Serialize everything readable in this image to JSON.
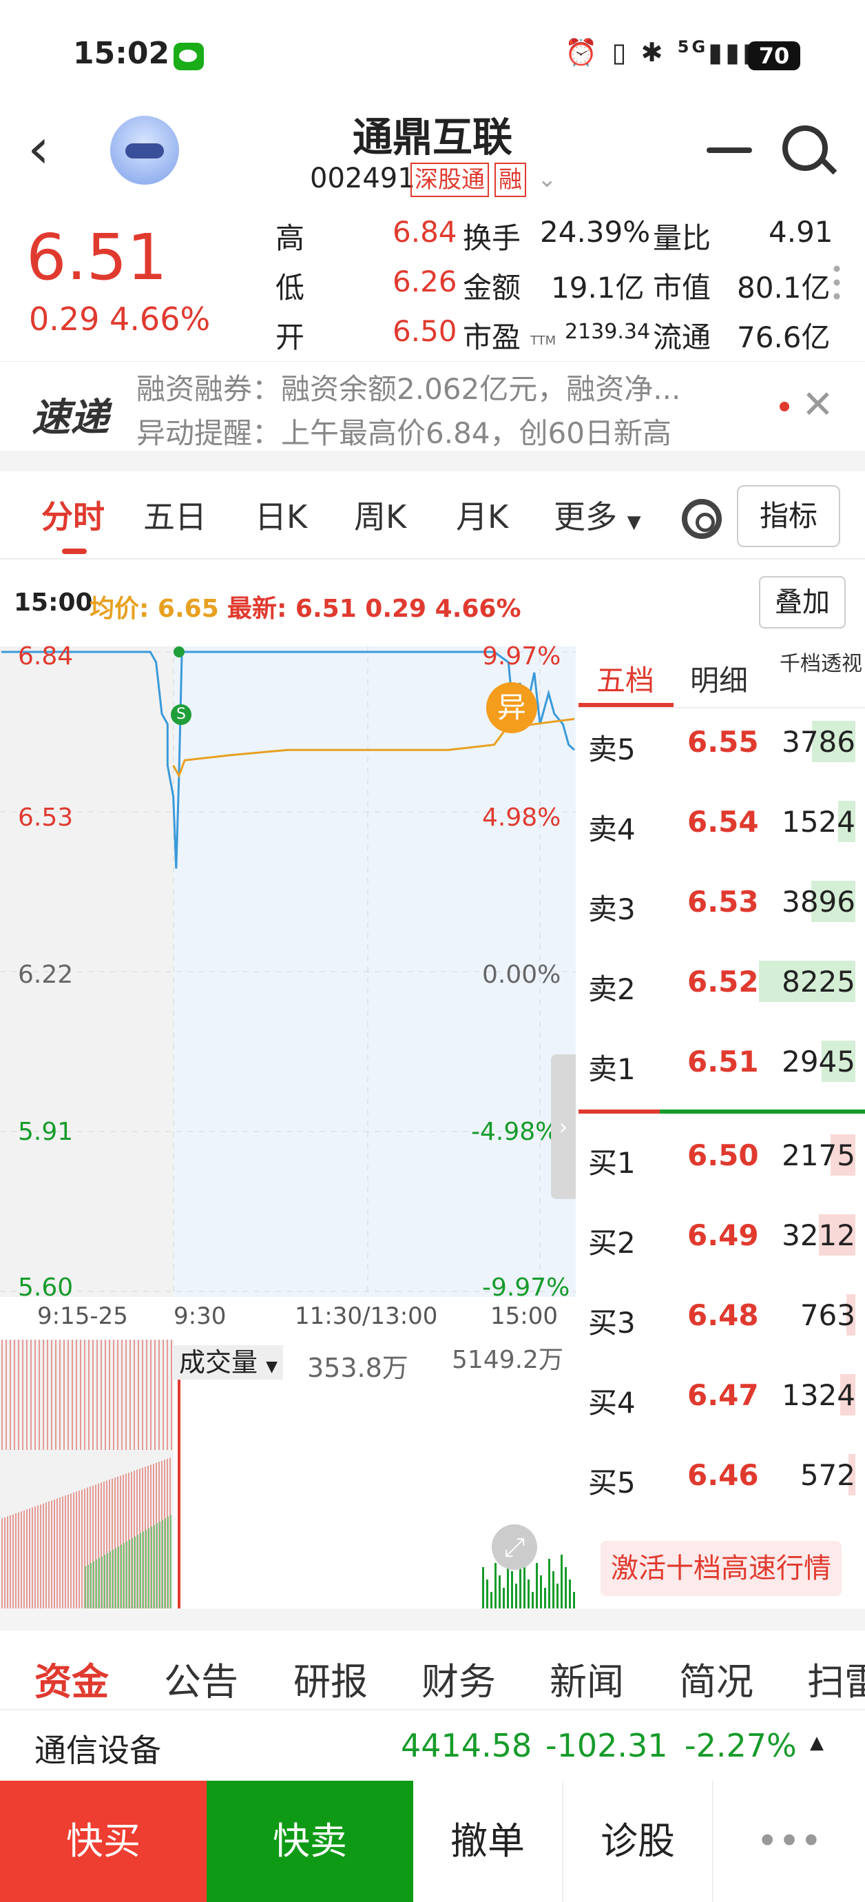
{
  "status_bar": {
    "time": "15:02",
    "network": "5G",
    "battery": "70"
  },
  "header": {
    "name": "通鼎互联",
    "code": "002491",
    "tag1": "深股通",
    "tag2": "融"
  },
  "quote": {
    "price": "6.51",
    "change": "0.29",
    "change_pct": "4.66%",
    "fields": [
      {
        "label": "高",
        "value": "6.84",
        "label2": "换手",
        "value2": "24.39%",
        "label3": "量比",
        "value3": "4.91"
      },
      {
        "label": "低",
        "value": "6.26",
        "label2": "金额",
        "value2": "19.1亿",
        "label3": "市值",
        "value3": "80.1亿"
      },
      {
        "label": "开",
        "value": "6.50",
        "label2": "市盈",
        "sub2": "TTM",
        "value2": "2139.34",
        "label3": "流通",
        "value3": "76.6亿"
      }
    ]
  },
  "news": {
    "logo": "速递",
    "line1": "融资融券：融资余额2.062亿元，融资净...",
    "line2": "异动提醒：上午最高价6.84，创60日新高"
  },
  "tabs": [
    "分时",
    "五日",
    "日K",
    "周K",
    "月K",
    "更多"
  ],
  "index_button": "指标",
  "info": {
    "time": "15:00",
    "avg_label": "均价: 6.65",
    "latest_label": "最新: 6.51 0.29 4.66%"
  },
  "overlay_button": "叠加",
  "chart_data": {
    "type": "line",
    "y_left_ticks": [
      "6.84",
      "6.53",
      "6.22",
      "5.91",
      "5.60"
    ],
    "y_right_ticks": [
      "9.97%",
      "4.98%",
      "0.00%",
      "-4.98%",
      "-9.97%"
    ],
    "x_ticks": [
      "9:15-25",
      "9:30",
      "11:30/13:00",
      "15:00"
    ],
    "ylim": [
      5.6,
      6.84
    ],
    "prev_close": 6.22,
    "marker_s": "S",
    "marker_yi": "异",
    "series": [
      {
        "name": "price",
        "color": "#3a9ad9",
        "values": [
          [
            0,
            6.84
          ],
          [
            0.12,
            6.84
          ],
          [
            0.26,
            6.84
          ],
          [
            0.27,
            6.82
          ],
          [
            0.28,
            6.72
          ],
          [
            0.29,
            6.7
          ],
          [
            0.29,
            6.62
          ],
          [
            0.3,
            6.56
          ],
          [
            0.305,
            6.42
          ],
          [
            0.31,
            6.6
          ],
          [
            0.315,
            6.84
          ],
          [
            0.32,
            6.84
          ],
          [
            0.5,
            6.84
          ],
          [
            0.78,
            6.84
          ],
          [
            0.86,
            6.84
          ],
          [
            0.885,
            6.82
          ],
          [
            0.895,
            6.7
          ],
          [
            0.905,
            6.78
          ],
          [
            0.915,
            6.72
          ],
          [
            0.93,
            6.8
          ],
          [
            0.94,
            6.7
          ],
          [
            0.955,
            6.76
          ],
          [
            0.965,
            6.72
          ],
          [
            0.98,
            6.7
          ],
          [
            0.99,
            6.66
          ],
          [
            1.0,
            6.65
          ]
        ]
      },
      {
        "name": "avg",
        "color": "#e8a020",
        "values": [
          [
            0.3,
            6.62
          ],
          [
            0.31,
            6.6
          ],
          [
            0.32,
            6.63
          ],
          [
            0.4,
            6.64
          ],
          [
            0.5,
            6.65
          ],
          [
            0.62,
            6.65
          ],
          [
            0.78,
            6.65
          ],
          [
            0.86,
            6.66
          ],
          [
            0.88,
            6.69
          ],
          [
            0.93,
            6.7
          ],
          [
            1.0,
            6.71
          ]
        ]
      }
    ],
    "volume_label": "成交量",
    "volume_value": "353.8万",
    "volume_max": "5149.2万"
  },
  "book": {
    "tabs": [
      "五档",
      "明细",
      "千档透视"
    ],
    "asks": [
      {
        "label": "卖5",
        "price": "6.55",
        "volume": "3786",
        "bar": 0.45
      },
      {
        "label": "卖4",
        "price": "6.54",
        "volume": "1524",
        "bar": 0.18
      },
      {
        "label": "卖3",
        "price": "6.53",
        "volume": "3896",
        "bar": 0.46
      },
      {
        "label": "卖2",
        "price": "6.52",
        "volume": "8225",
        "bar": 1.0
      },
      {
        "label": "卖1",
        "price": "6.51",
        "volume": "2945",
        "bar": 0.35
      }
    ],
    "bids": [
      {
        "label": "买1",
        "price": "6.50",
        "volume": "2175",
        "bar": 0.26
      },
      {
        "label": "买2",
        "price": "6.49",
        "volume": "3212",
        "bar": 0.38
      },
      {
        "label": "买3",
        "price": "6.48",
        "volume": "763",
        "bar": 0.09
      },
      {
        "label": "买4",
        "price": "6.47",
        "volume": "1324",
        "bar": 0.16
      },
      {
        "label": "买5",
        "price": "6.46",
        "volume": "572",
        "bar": 0.07
      }
    ],
    "activate": "激活十档高速行情"
  },
  "bottom_tabs": [
    "资金",
    "公告",
    "研报",
    "财务",
    "新闻",
    "简况",
    "扫雷"
  ],
  "industry": {
    "name": "通信设备",
    "value": "4414.58",
    "change": "-102.31",
    "pct": "-2.27%"
  },
  "actions": [
    "快买",
    "快卖",
    "撤单",
    "诊股",
    "•••"
  ],
  "colors": {
    "up": "#e03a2f",
    "down": "#169b2a",
    "price_line": "#3a9ad9",
    "avg_line": "#e8a020"
  }
}
